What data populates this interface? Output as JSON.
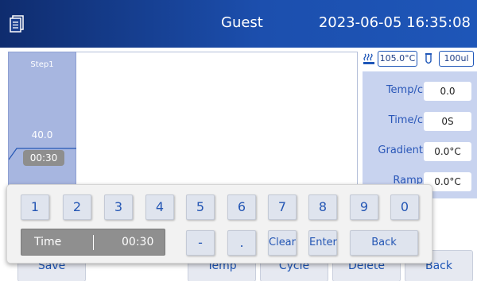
{
  "header": {
    "user": "Guest",
    "datetime": "2023-06-05 16:35:08"
  },
  "step": {
    "label": "Step1",
    "temp": "40.0",
    "time": "00:30"
  },
  "status": {
    "lid_temp": "105.0°C",
    "volume": "100ul"
  },
  "params": [
    {
      "label": "Temp/c",
      "value": "0.0"
    },
    {
      "label": "Time/c",
      "value": "0S"
    },
    {
      "label": "Gradient",
      "value": "0.0°C"
    },
    {
      "label": "Ramp",
      "value": "0.0°C"
    }
  ],
  "bottom_buttons": [
    "Save",
    "Temp",
    "Cycle",
    "Delete",
    "Back"
  ],
  "keypad": {
    "digits": [
      "1",
      "2",
      "3",
      "4",
      "5",
      "6",
      "7",
      "8",
      "9",
      "0"
    ],
    "field_label": "Time",
    "field_value": "00:30",
    "minus": "-",
    "dot": ".",
    "clear": "Clear",
    "enter": "Enter",
    "back": "Back"
  },
  "colors": {
    "header_start": "#0f2c6e",
    "header_end": "#1e56b8",
    "accent_text": "#2456b4",
    "step_bg": "#a7b6e0",
    "params_bg": "#c8d3ef"
  },
  "icons": {
    "menu": "document-list-icon",
    "lid": "heating-icon",
    "sample": "tube-icon"
  }
}
